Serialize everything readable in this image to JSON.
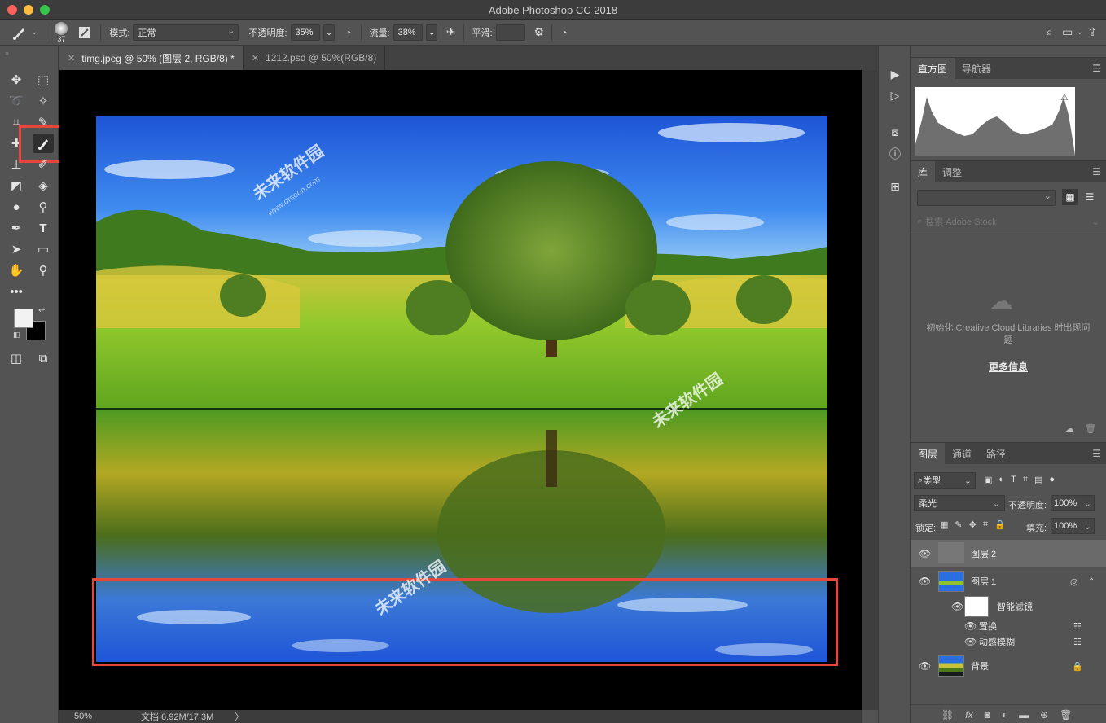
{
  "titlebar": {
    "title": "Adobe Photoshop CC 2018"
  },
  "options": {
    "brush_size": "37",
    "mode_label": "模式:",
    "mode_value": "正常",
    "opacity_label": "不透明度:",
    "opacity_value": "35%",
    "flow_label": "流量:",
    "flow_value": "38%",
    "smooth_label": "平滑:"
  },
  "tabs": [
    {
      "label": "timg.jpeg @ 50% (图层 2, RGB/8) *"
    },
    {
      "label": "1212.psd @ 50%(RGB/8)"
    }
  ],
  "status": {
    "zoom": "50%",
    "doc_info": "文档:6.92M/17.3M",
    "arrow": "〉"
  },
  "histogram_panel": {
    "tab1": "直方图",
    "tab2": "导航器"
  },
  "library_panel": {
    "tab1": "库",
    "tab2": "调整",
    "search_placeholder": "搜索 Adobe Stock",
    "message": "初始化 Creative Cloud Libraries 时出现问题",
    "more_info": "更多信息"
  },
  "layers_panel": {
    "tab1": "图层",
    "tab2": "通道",
    "tab3": "路径",
    "filter_type": "类型",
    "blend_mode": "柔光",
    "opacity_label": "不透明度:",
    "opacity_value": "100%",
    "lock_label": "锁定:",
    "fill_label": "填充:",
    "fill_value": "100%",
    "layers": [
      {
        "name": "图层 2"
      },
      {
        "name": "图层 1"
      },
      {
        "name": "智能滤镜"
      },
      {
        "name": "置换"
      },
      {
        "name": "动感模糊"
      },
      {
        "name": "背景"
      }
    ]
  },
  "watermark": {
    "brand": "未来软件园",
    "site": "www.orsoon.com"
  },
  "colors": {
    "highlight": "#e8463c",
    "panel_bg": "#535353",
    "dark_bg": "#3c3c3c",
    "sky_blue": "#1f5fd8",
    "grass_green": "#7fbf2a"
  }
}
